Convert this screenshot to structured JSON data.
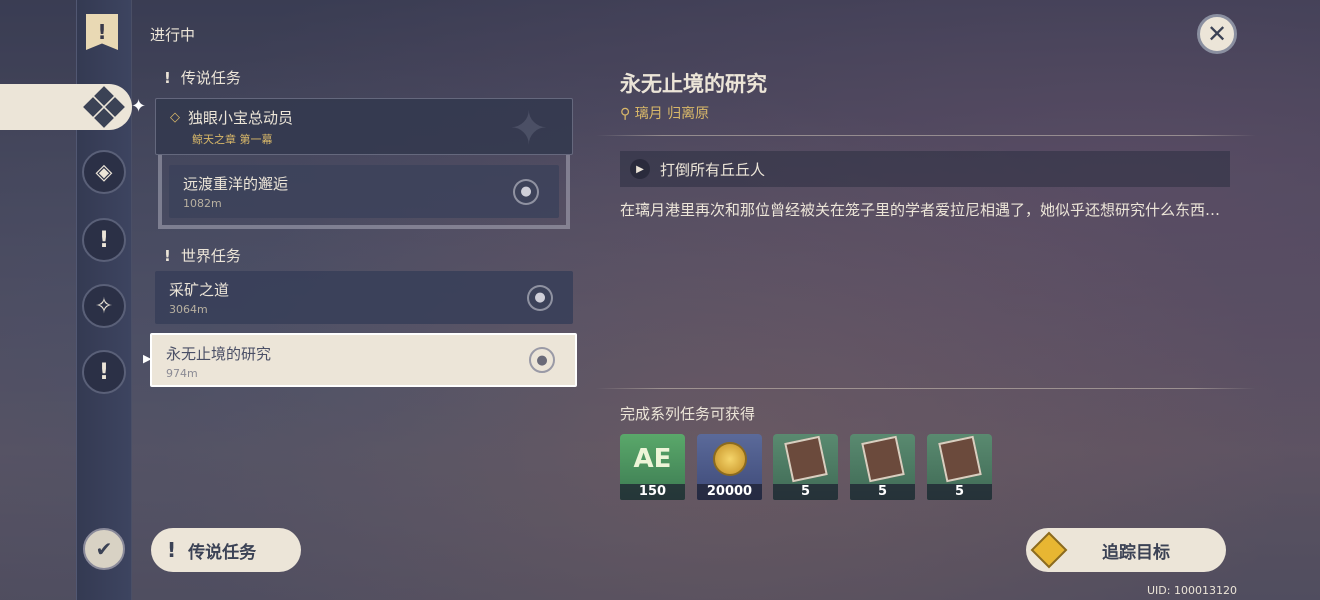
{
  "header": {
    "in_progress": "进行中"
  },
  "categories": {
    "legend": "传说任务",
    "world": "世界任务"
  },
  "quests": {
    "legend_main": {
      "name": "独眼小宝总动员",
      "chapter": "鲸天之章 第一幕"
    },
    "legend_sub": {
      "name": "远渡重洋的邂逅",
      "distance": "1082m"
    },
    "world_1": {
      "name": "采矿之道",
      "distance": "3064m"
    },
    "world_2": {
      "name": "永无止境的研究",
      "distance": "974m"
    }
  },
  "detail": {
    "title": "永无止境的研究",
    "location": "璃月 归离原",
    "objective": "打倒所有丘丘人",
    "description": "在璃月港里再次和那位曾经被关在笼子里的学者爱拉尼相遇了，她似乎还想研究什么东西…",
    "rewards_title": "完成系列任务可获得",
    "rewards": [
      {
        "icon": "adventure-exp-icon",
        "count": "150"
      },
      {
        "icon": "mora-coin-icon",
        "count": "20000"
      },
      {
        "icon": "talent-book-icon",
        "count": "5"
      },
      {
        "icon": "talent-book-icon",
        "count": "5"
      },
      {
        "icon": "talent-book-icon",
        "count": "5"
      }
    ]
  },
  "buttons": {
    "legend_quests": "传说任务",
    "track": "追踪目标"
  },
  "uid": "UID: 100013120",
  "colors": {
    "accent_gold": "#d9b869",
    "cream": "#ece5d8",
    "dark_slate": "#3b4255"
  }
}
